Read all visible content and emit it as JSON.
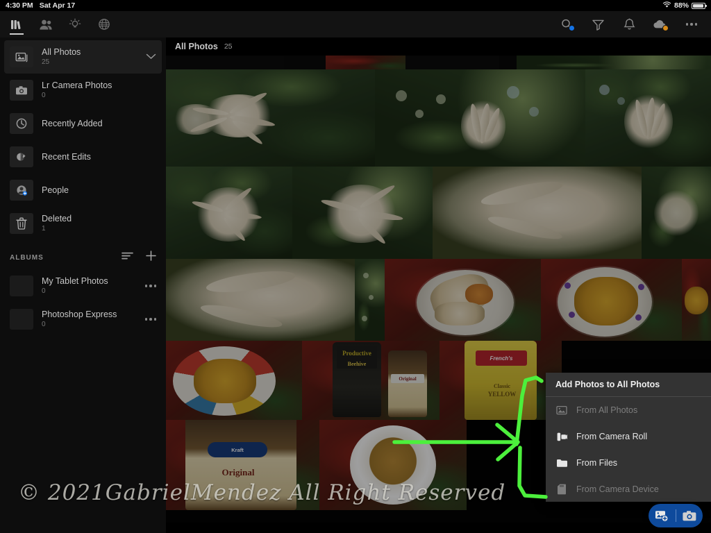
{
  "status_bar": {
    "time": "4:30 PM",
    "date": "Sat Apr 17",
    "battery_percent": "88%",
    "wifi_icon": "wifi-icon",
    "battery_icon": "battery-icon"
  },
  "toolbar": {
    "left_items": [
      {
        "name": "library-icon",
        "label": "Library",
        "active": true
      },
      {
        "name": "people-icon",
        "label": "People",
        "active": false
      },
      {
        "name": "lightbulb-icon",
        "label": "Learn",
        "active": false
      },
      {
        "name": "globe-icon",
        "label": "Discover",
        "active": false
      }
    ],
    "right_items": [
      {
        "name": "search-icon",
        "label": "Search",
        "badge": "blue"
      },
      {
        "name": "filter-icon",
        "label": "Filter",
        "badge": ""
      },
      {
        "name": "bell-icon",
        "label": "Notifications",
        "badge": ""
      },
      {
        "name": "cloud-icon",
        "label": "Sync Status",
        "badge": "amber"
      },
      {
        "name": "more-options-icon",
        "label": "More",
        "badge": ""
      }
    ]
  },
  "sidebar": {
    "nav_items": [
      {
        "label": "All Photos",
        "count": "25",
        "icon": "photos-icon",
        "selected": true,
        "chevron": true
      },
      {
        "label": "Lr Camera Photos",
        "count": "0",
        "icon": "camera-icon",
        "selected": false,
        "chevron": false
      },
      {
        "label": "Recently Added",
        "count": "",
        "icon": "clock-icon",
        "selected": false,
        "chevron": false
      },
      {
        "label": "Recent Edits",
        "count": "",
        "icon": "edits-icon",
        "selected": false,
        "chevron": false
      },
      {
        "label": "People",
        "count": "",
        "icon": "person-icon",
        "selected": false,
        "chevron": false
      },
      {
        "label": "Deleted",
        "count": "1",
        "icon": "trash-icon",
        "selected": false,
        "chevron": false
      }
    ],
    "albums_section": {
      "title": "ALBUMS",
      "sort_icon": "sort-icon",
      "add_icon": "plus-icon",
      "albums": [
        {
          "label": "My Tablet Photos",
          "count": "0",
          "more_icon": "more-icon"
        },
        {
          "label": "Photoshop Express",
          "count": "0",
          "more_icon": "more-icon"
        }
      ]
    }
  },
  "content": {
    "title": "All Photos",
    "count": "25"
  },
  "context_menu": {
    "header": "Add Photos to All Photos",
    "items": [
      {
        "label": "From All Photos",
        "icon": "photo-icon",
        "disabled": true
      },
      {
        "label": "From Camera Roll",
        "icon": "camera-roll-icon",
        "disabled": false
      },
      {
        "label": "From Files",
        "icon": "folder-icon",
        "disabled": false
      },
      {
        "label": "From Camera Device",
        "icon": "sd-card-icon",
        "disabled": true
      }
    ]
  },
  "fab": {
    "add_photos_icon": "add-photos-icon",
    "camera_icon": "camera-icon"
  },
  "annotation": {
    "color": "#4cf03c",
    "shape": "arrow-pointing-to-menu"
  },
  "watermark": {
    "text": "© 2021GabrielMendez All Right Reserved"
  },
  "colors": {
    "accent_blue": "#1473e6",
    "fab_blue": "#0e4a9c",
    "menu_bg": "#333333",
    "sidebar_bg": "#0d0d0d",
    "annotation_green": "#4cf03c"
  }
}
